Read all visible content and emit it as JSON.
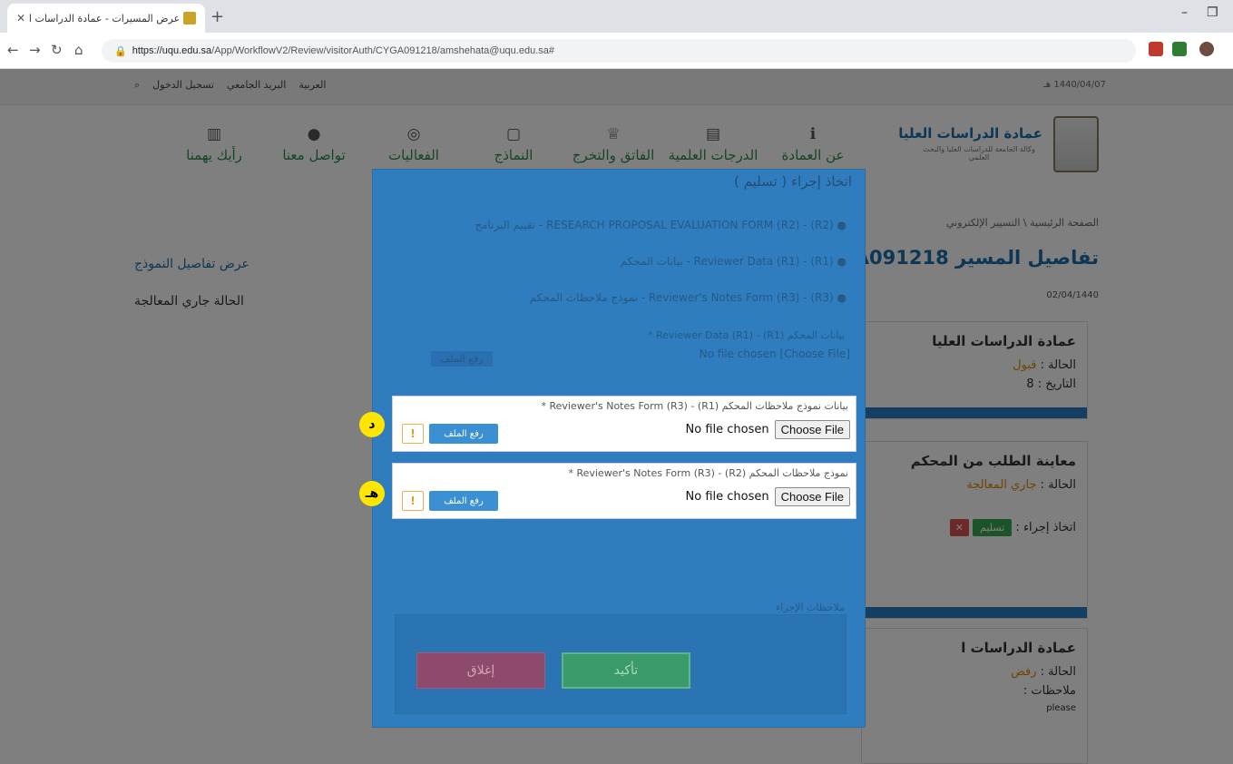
{
  "browser": {
    "tab_title": "عرض المسيرات - عمادة الدراسات ا",
    "url_host": "https://uqu.edu.sa",
    "url_path": "/App/WorkflowV2/Review/visitorAuth/CYGA091218/amshehata@uqu.edu.sa#",
    "minimize": "–",
    "restore": "❐"
  },
  "topstrip": {
    "date": "1440/04/07 هـ",
    "login": "تسجيل الدخول",
    "mail": "البريد الجامعي",
    "language": "العربية"
  },
  "header": {
    "brand_title": "عمادة الدراسات العليا",
    "brand_sub": "وكالة الجامعة للدراسات العليا والبحث العلمي",
    "nav": [
      "عن العمادة",
      "الدرجات العلمية",
      "الفاتق والتخرج",
      "النماذج",
      "الفعاليات",
      "تواصل معنا",
      "رأيك يهمنا"
    ]
  },
  "page": {
    "breadcrumb": "الصفحة الرئيسية \\ التسيير الإلكتروني",
    "title": "تفاصيل المسير CYGA091218",
    "date": "02/04/1440",
    "view_details": "عرض تفاصيل النموذج",
    "status": "الحالة جاري المعالجة"
  },
  "cards": {
    "c1_title": "عمادة الدراسات العليا",
    "c1_status_label": "الحالة : ",
    "c1_status_value": "قبول",
    "c1_date_label": "التاريخ : 8",
    "c2_title": "معاينة الطلب من المحكم",
    "c2_status_label": "الحالة : ",
    "c2_status_value": "جاري المعالجة",
    "c2_action_label": "اتخاذ إجراء : ",
    "c2_submit": "تسليم",
    "c3_title": "عمادة الدراسات ا",
    "c3_status_label": "الحالة : ",
    "c3_status_value": "رفض",
    "c3_notes_label": "ملاحظات :",
    "c3_notes_value": "please"
  },
  "modal": {
    "title": "اتخاذ إجراء ( تسليم )",
    "items": [
      "(R2) - RESEARCH PROPOSAL EVALUATION FORM (R2) - تقييم البرنامج",
      "(R1) - Reviewer Data (R1) - بيانات المحكم",
      "(R3) - Reviewer's Notes Form (R3) - نموذج ملاحظات المحكم"
    ],
    "dim_label": "بيانات المحكم (R1) - Reviewer Data (R1) *",
    "notes_label": "ملاحظات الإجراء",
    "upload_label": "رفع الملف",
    "confirm": "تأكيد",
    "close": "إغلاق"
  },
  "upload_rows": [
    {
      "label": "بيانات نموذج ملاحظات المحكم (R1) - Reviewer's Notes Form (R3) *",
      "marker": "د"
    },
    {
      "label": "نموذج ملاحظات المحكم (R2) - Reviewer's Notes Form (R3) *",
      "marker": "هـ"
    }
  ],
  "file_input": {
    "choose": "Choose File",
    "none": "No file chosen"
  },
  "colors": {
    "accent": "#2f7dbf",
    "brand": "#1a6fa8",
    "green": "#39a752",
    "marker": "#ffe600"
  }
}
